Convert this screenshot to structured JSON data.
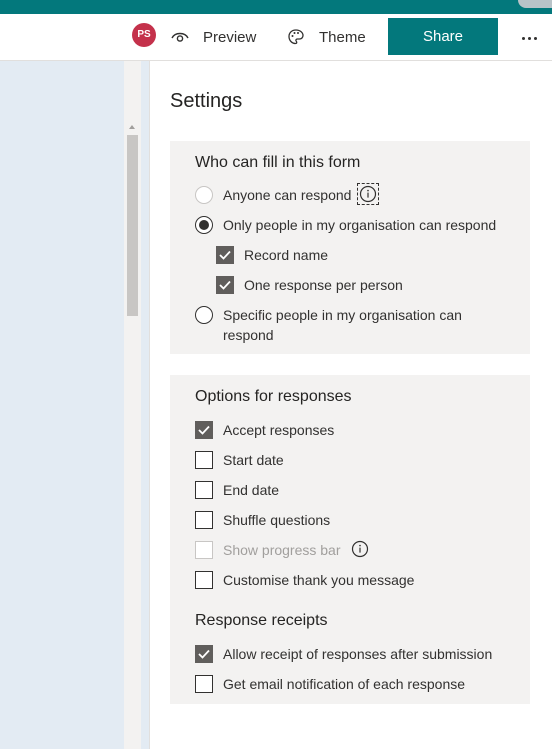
{
  "header": {
    "avatar_initials": "PS",
    "preview_label": "Preview",
    "theme_label": "Theme",
    "share_label": "Share",
    "more_icon": "more-horizontal-icon"
  },
  "settings": {
    "title": "Settings",
    "who_can_fill": {
      "title": "Who can fill in this form",
      "anyone": "Anyone can respond",
      "only_org": "Only people in my organisation can respond",
      "record_name": "Record name",
      "one_response": "One response per person",
      "specific_line1": "Specific people in my organisation can",
      "specific_line2": "respond"
    },
    "options": {
      "title": "Options for responses",
      "accept": "Accept responses",
      "start_date": "Start date",
      "end_date": "End date",
      "shuffle": "Shuffle questions",
      "progress": "Show progress bar",
      "thank_you": "Customise thank you message"
    },
    "receipts": {
      "title": "Response receipts",
      "allow_receipt": "Allow receipt of responses after submission",
      "email_notify": "Get email notification of each response"
    }
  },
  "colors": {
    "brand": "#03787c",
    "avatar": "#c4314b",
    "panel": "#f3f2f1",
    "left_pane": "#e3ebf3"
  }
}
